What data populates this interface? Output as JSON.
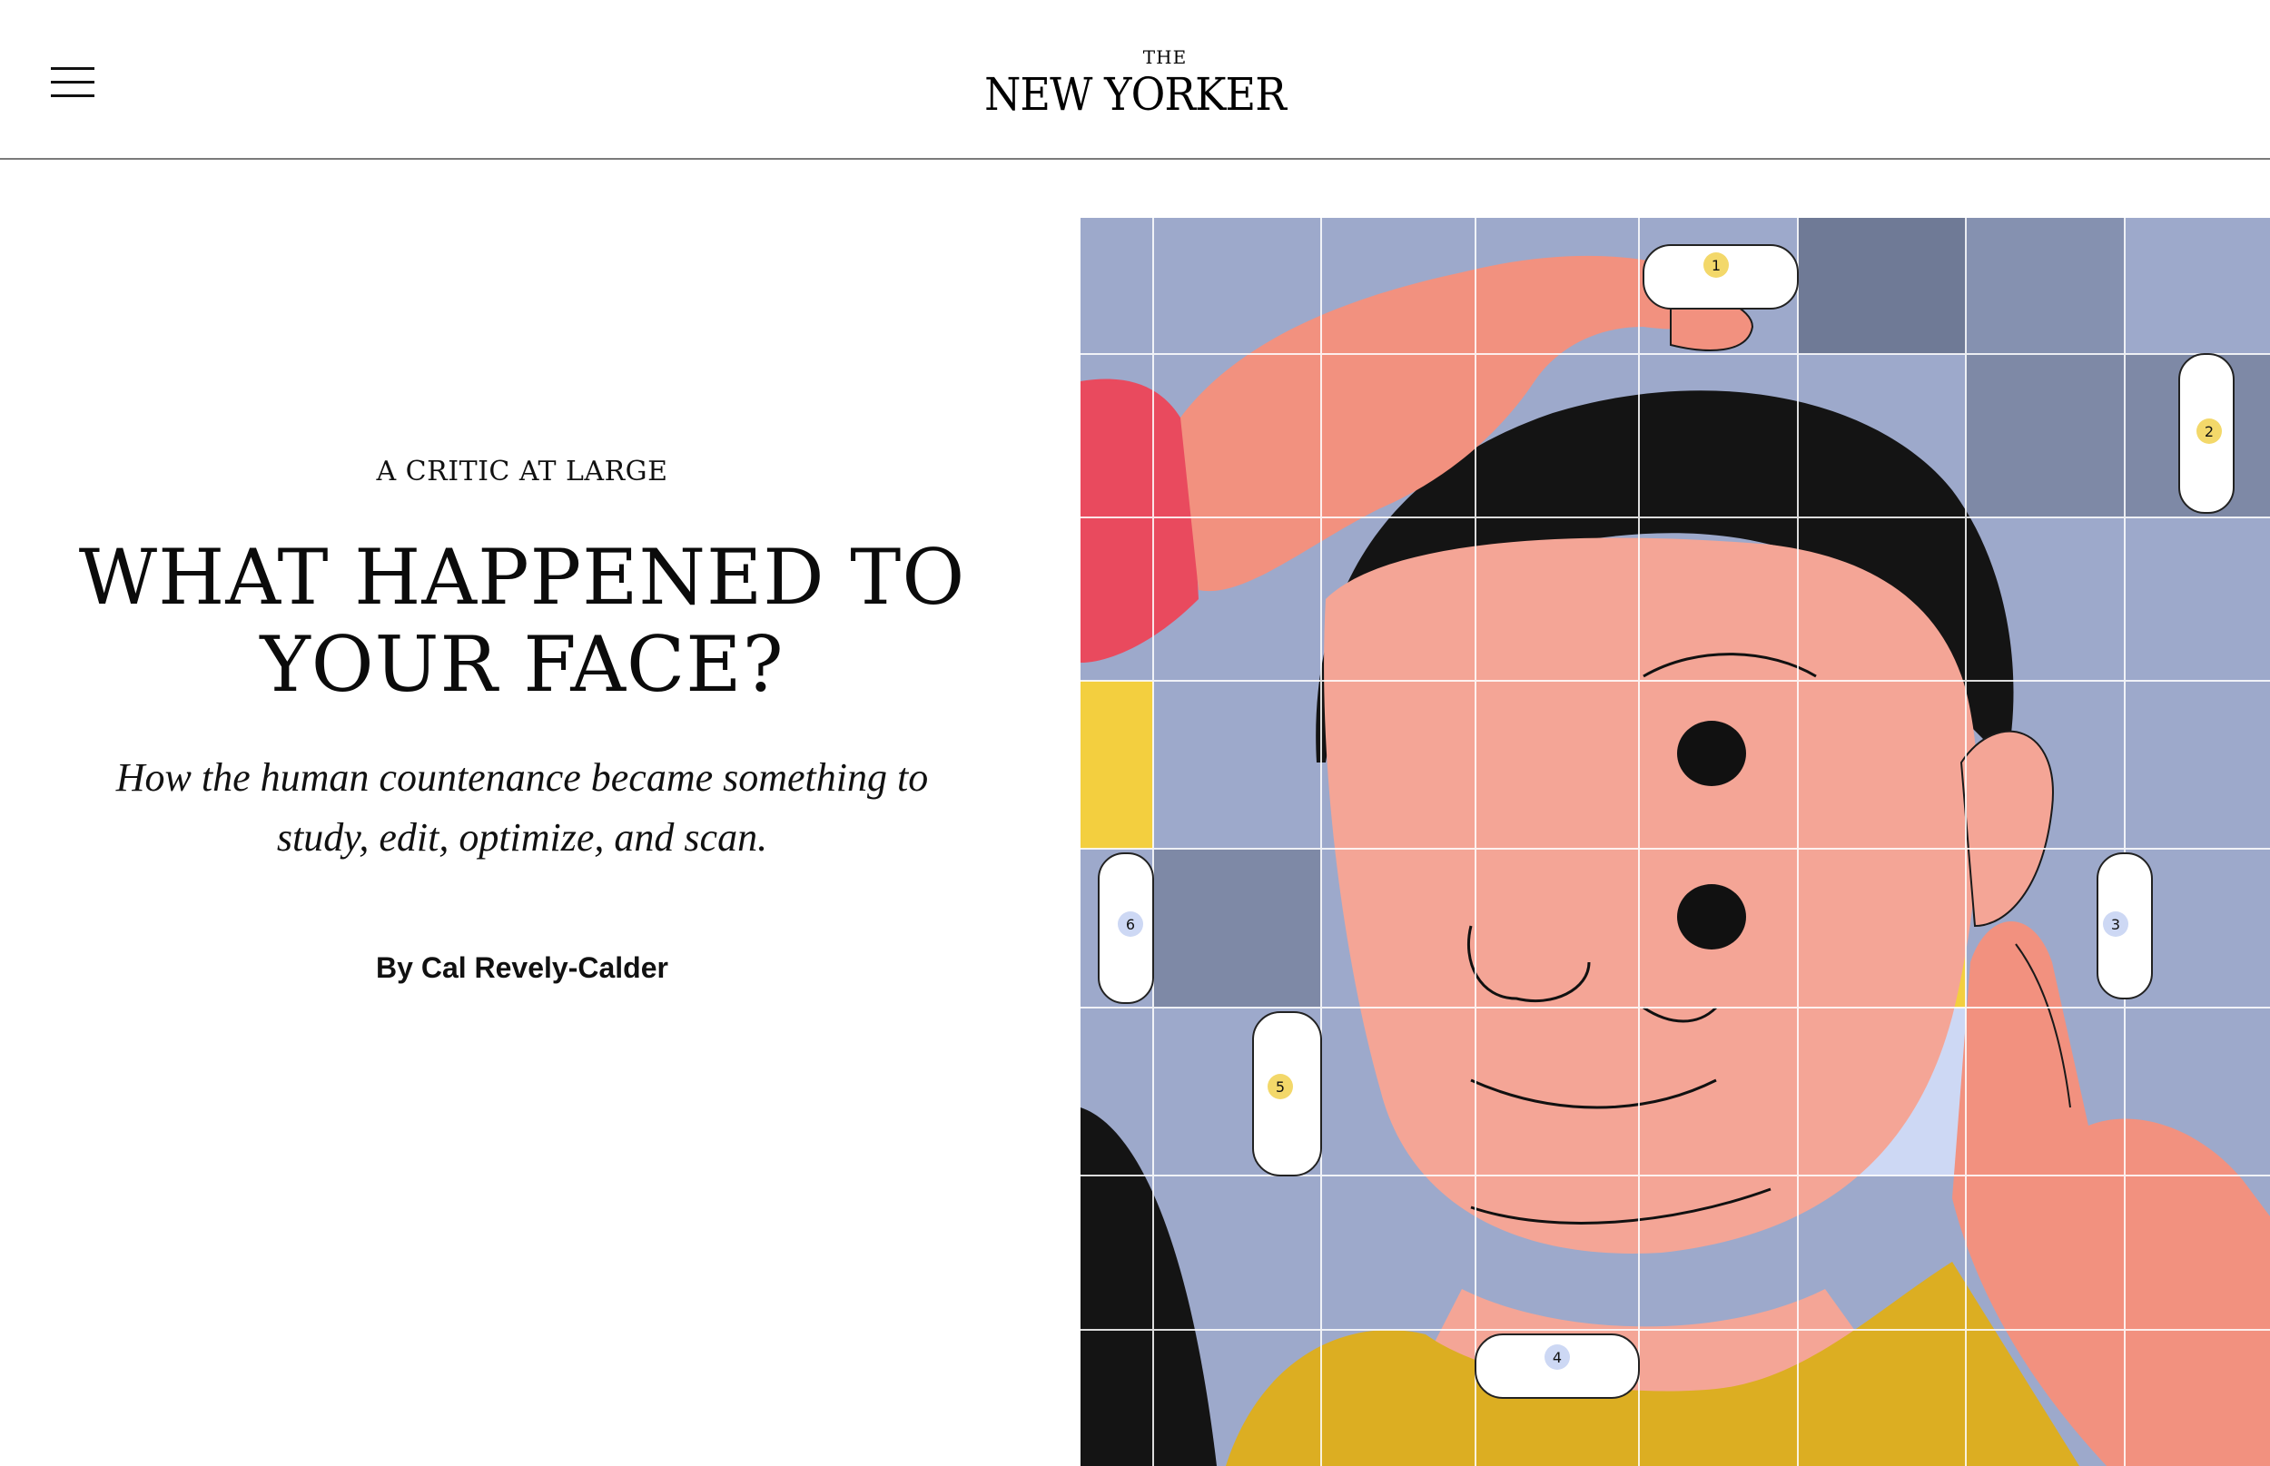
{
  "header": {
    "logo_small": "THE",
    "logo_main": "NEW YORKER"
  },
  "article": {
    "rubric": "A CRITIC AT LARGE",
    "headline_line1": "WHAT HAPPENED TO",
    "headline_line2": "YOUR FACE?",
    "dek_line1": "How the human countenance became something to",
    "dek_line2": "study, edit, optimize, and scan.",
    "byline": "By Cal Revely-Calder"
  },
  "illustration": {
    "tile_labels": [
      "1",
      "2",
      "3",
      "4",
      "5",
      "6"
    ]
  },
  "colors": {
    "background": "#ffffff",
    "header_rule": "#7a7a7a",
    "tile_blue": "#9da9cb",
    "tile_yellow": "#f3cf3f",
    "skin": "#f4a596",
    "hair": "#141414",
    "sleeve": "#e94a5e"
  }
}
